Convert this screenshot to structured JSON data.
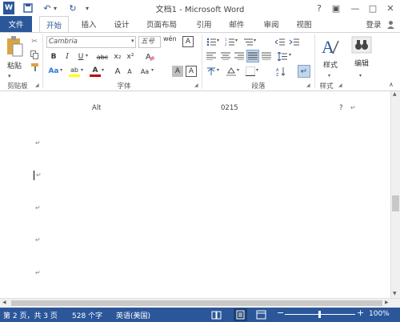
{
  "window": {
    "title": "文档1 - Microsoft Word",
    "help": "?",
    "restore": "▣",
    "minimize": "—",
    "maximize": "□",
    "close": "✕"
  },
  "quick_access": {
    "word_icon": "W",
    "save": "💾",
    "undo": "↶",
    "undo_dropdown": "▾",
    "redo": "↻",
    "customize": "▾"
  },
  "tabs": [
    {
      "label": "文件"
    },
    {
      "label": "开始"
    },
    {
      "label": "插入"
    },
    {
      "label": "设计"
    },
    {
      "label": "页面布局"
    },
    {
      "label": "引用"
    },
    {
      "label": "邮件"
    },
    {
      "label": "审阅"
    },
    {
      "label": "视图"
    }
  ],
  "login": "登录",
  "ribbon": {
    "clipboard": {
      "paste_label": "粘贴",
      "group_label": "剪贴板"
    },
    "font": {
      "font_name": "Cambria",
      "font_size": "五号",
      "group_label": "字体",
      "bold": "B",
      "italic": "I",
      "underline": "U",
      "strike": "abc",
      "subscript": "x₂",
      "superscript": "x²",
      "grow": "A",
      "shrink": "A",
      "aa": "Aa",
      "clear": "A",
      "font_color": "A",
      "highlight": "ab",
      "char_border": "A",
      "char_shade": "A",
      "wen": "wén",
      "A_box": "A"
    },
    "paragraph": {
      "group_label": "段落"
    },
    "styles": {
      "label": "样式",
      "group_label": "样式"
    },
    "editing": {
      "label": "编辑"
    }
  },
  "document": {
    "table_row": [
      "Alt",
      "0215",
      "?"
    ],
    "para_mark": "↵"
  },
  "status": {
    "page": "第 2 页，共 3 页",
    "words": "528 个字",
    "lang": "英语(美国)",
    "zoom_minus": "−",
    "zoom_plus": "+",
    "zoom": "100%"
  },
  "colors": {
    "accent": "#2b579a",
    "highlight": "#ffff00",
    "font_color": "#c00000"
  }
}
